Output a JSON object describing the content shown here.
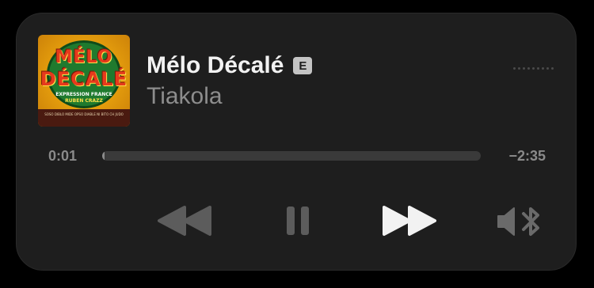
{
  "colors": {
    "background": "#000000",
    "panel": "#1e1e1e",
    "title": "#f2f2f2",
    "artist": "#8d8d8d",
    "time_text": "#8a8a8a",
    "track_bar": "#3a3a3a",
    "active_control": "#f2f2f2",
    "disabled_control": "#5c5c5c"
  },
  "artwork": {
    "title_line1": "MÉLO",
    "title_line2": "DÉCALÉ",
    "subtitle_line1": "EXPRESSION FRANCE",
    "subtitle_line2": "RUBEN CRAZZ",
    "footer": "SOSO DIBLO MIDE OPSO DIABLE NI BITO CH JUDO"
  },
  "track": {
    "title": "Mélo Décalé",
    "explicit_badge": "E",
    "artist": "Tiakola"
  },
  "more_icon": "ellipsis-icon",
  "progress": {
    "elapsed": "0:01",
    "remaining": "−2:35",
    "fraction": 0.006
  },
  "controls": {
    "rewind_icon": "rewind-icon",
    "pause_icon": "pause-icon",
    "forward_icon": "fast-forward-icon",
    "audio_route_icon": "speaker-bluetooth-icon"
  }
}
